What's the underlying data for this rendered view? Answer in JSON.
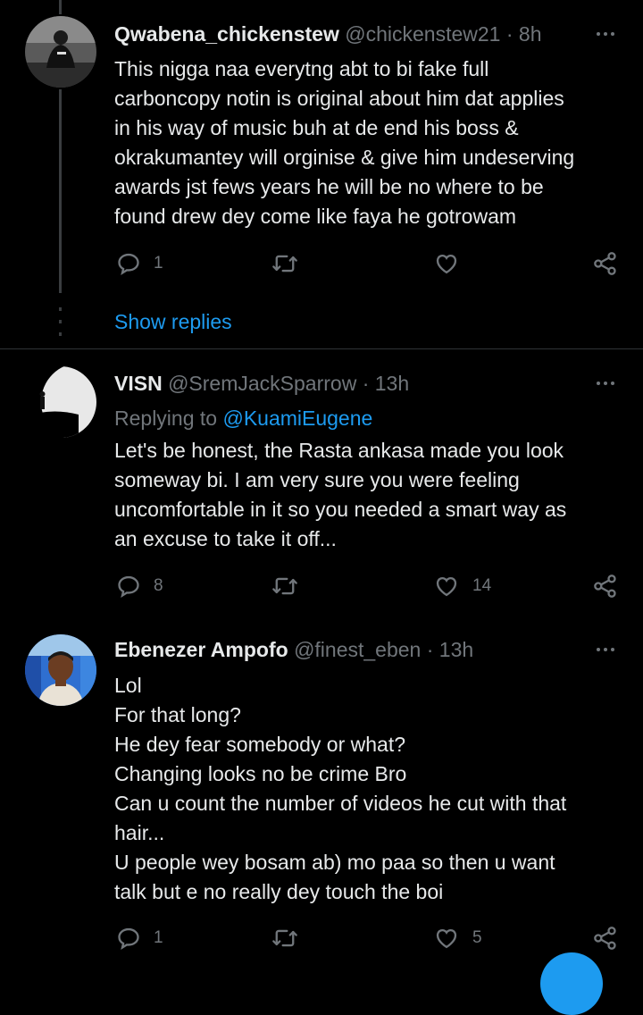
{
  "colors": {
    "background": "#000000",
    "text": "#e7e9ea",
    "muted": "#71767b",
    "accent": "#1d9bf0",
    "divider": "#2f3336"
  },
  "tweets": [
    {
      "name": "Qwabena_chickenstew",
      "handle": "@chickenstew21",
      "separator": "·",
      "time": "8h",
      "lines": [
        "This nigga naa everytng abt to bi fake full",
        "carboncopy notin is original about him dat applies",
        "in his way of music buh at de end his boss &",
        "okrakumantey will orginise & give him undeserving",
        "awards jst fews years he will be no where to be",
        "found drew dey come like faya he gotrowam"
      ],
      "reply_count": "1",
      "retweet_count": "",
      "like_count": "",
      "show_replies": "Show replies"
    },
    {
      "name": "VISN",
      "handle": "@SremJackSparrow",
      "separator": "·",
      "time": "13h",
      "replying_label": "Replying to",
      "replying_to": "@KuamiEugene",
      "lines": [
        "Let's be honest, the Rasta ankasa made you look",
        "someway bi. I am very sure you were feeling",
        "uncomfortable in it so you needed a smart way as",
        "an excuse to take it off..."
      ],
      "reply_count": "8",
      "retweet_count": "",
      "like_count": "14"
    },
    {
      "name": "Ebenezer Ampofo",
      "handle": "@finest_eben",
      "separator": "·",
      "time": "13h",
      "lines": [
        "Lol",
        "For that long?",
        "He dey fear somebody or what?",
        "Changing looks no be crime Bro",
        "Can u count the number of videos he cut with that",
        "hair...",
        "U people wey bosam ab) mo paa so then u want",
        "talk but e no really dey touch the boi"
      ],
      "reply_count": "1",
      "retweet_count": "",
      "like_count": "5"
    }
  ],
  "icons": {
    "reply": "reply-icon",
    "retweet": "retweet-icon",
    "like": "heart-icon",
    "share": "share-icon",
    "more": "more-icon"
  }
}
